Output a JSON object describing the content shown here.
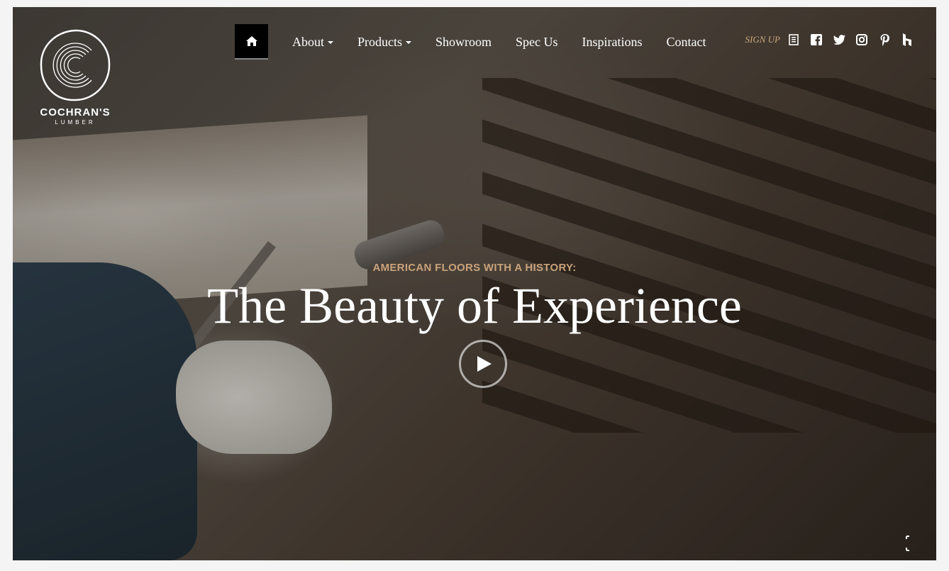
{
  "brand": {
    "name": "COCHRAN'S",
    "sub": "LUMBER",
    "logo_icon": "tree-ring-c-logo"
  },
  "nav": {
    "home_icon": "home-icon",
    "items": [
      {
        "label": "About",
        "dropdown": true
      },
      {
        "label": "Products",
        "dropdown": true
      },
      {
        "label": "Showroom",
        "dropdown": false
      },
      {
        "label": "Spec Us",
        "dropdown": false
      },
      {
        "label": "Inspirations",
        "dropdown": false
      },
      {
        "label": "Contact",
        "dropdown": false
      }
    ]
  },
  "social": {
    "signup": "SIGN UP",
    "icons": [
      "newsletter-icon",
      "facebook-icon",
      "twitter-icon",
      "instagram-icon",
      "pinterest-icon",
      "houzz-icon"
    ]
  },
  "hero": {
    "kicker": "AMERICAN FLOORS WITH A HISTORY:",
    "headline": "The Beauty of Experience",
    "play_icon": "play-icon",
    "fullscreen_icon": "fullscreen-icon"
  },
  "colors": {
    "accent": "#c9a27a",
    "nav_active_bg": "#000000",
    "text": "#ffffff"
  }
}
